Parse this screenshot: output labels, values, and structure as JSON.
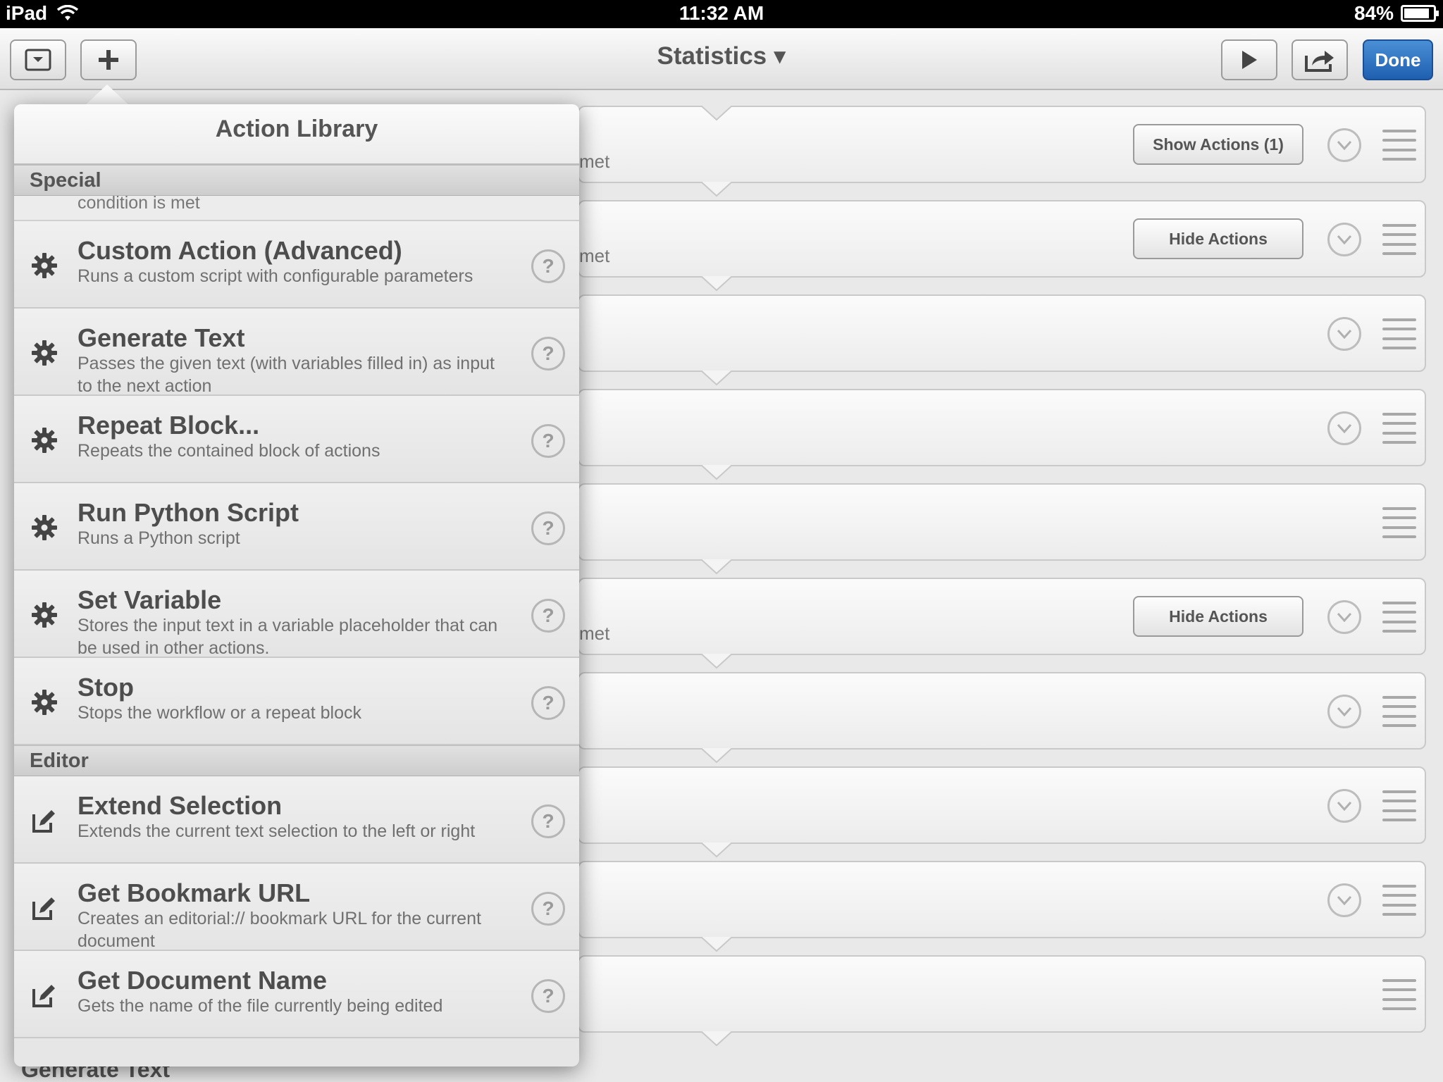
{
  "status_bar": {
    "device": "iPad",
    "time": "11:32 AM",
    "battery": "84%"
  },
  "toolbar": {
    "title": "Statistics ▾",
    "done_label": "Done"
  },
  "workflow": {
    "met_text": "met",
    "cards": [
      {
        "button": "Show Actions (1)",
        "met": true,
        "chevron": true
      },
      {
        "button": "Hide Actions",
        "met": true,
        "chevron": true
      },
      {
        "button": null,
        "met": false,
        "chevron": true
      },
      {
        "button": null,
        "met": false,
        "chevron": true
      },
      {
        "button": null,
        "met": false,
        "chevron": false
      },
      {
        "button": "Hide Actions",
        "met": true,
        "chevron": true
      },
      {
        "button": null,
        "met": false,
        "chevron": true
      },
      {
        "button": null,
        "met": false,
        "chevron": true
      },
      {
        "button": null,
        "met": false,
        "chevron": true
      },
      {
        "button": null,
        "met": false,
        "chevron": false
      }
    ],
    "bottom_peek": "Generate Text"
  },
  "library": {
    "title": "Action Library",
    "cut_text": "condition is met",
    "sections": [
      {
        "name": "Special",
        "icon": "gear-icon",
        "items": [
          {
            "title": "Custom Action (Advanced)",
            "desc": "Runs a custom script with configurable parameters"
          },
          {
            "title": "Generate Text",
            "desc": "Passes the given text (with variables filled in) as input to the next action"
          },
          {
            "title": "Repeat Block...",
            "desc": "Repeats the contained block of actions"
          },
          {
            "title": "Run Python Script",
            "desc": "Runs a Python script"
          },
          {
            "title": "Set Variable",
            "desc": "Stores the input text in a variable placeholder that can be used in other actions."
          },
          {
            "title": "Stop",
            "desc": "Stops the workflow or a repeat block"
          }
        ]
      },
      {
        "name": "Editor",
        "icon": "edit-icon",
        "items": [
          {
            "title": "Extend Selection",
            "desc": "Extends the current text selection to the left or right"
          },
          {
            "title": "Get Bookmark URL",
            "desc": "Creates an editorial:// bookmark URL for the current document"
          },
          {
            "title": "Get Document Name",
            "desc": "Gets the name of the file currently being edited"
          }
        ]
      }
    ],
    "help_glyph": "?"
  }
}
